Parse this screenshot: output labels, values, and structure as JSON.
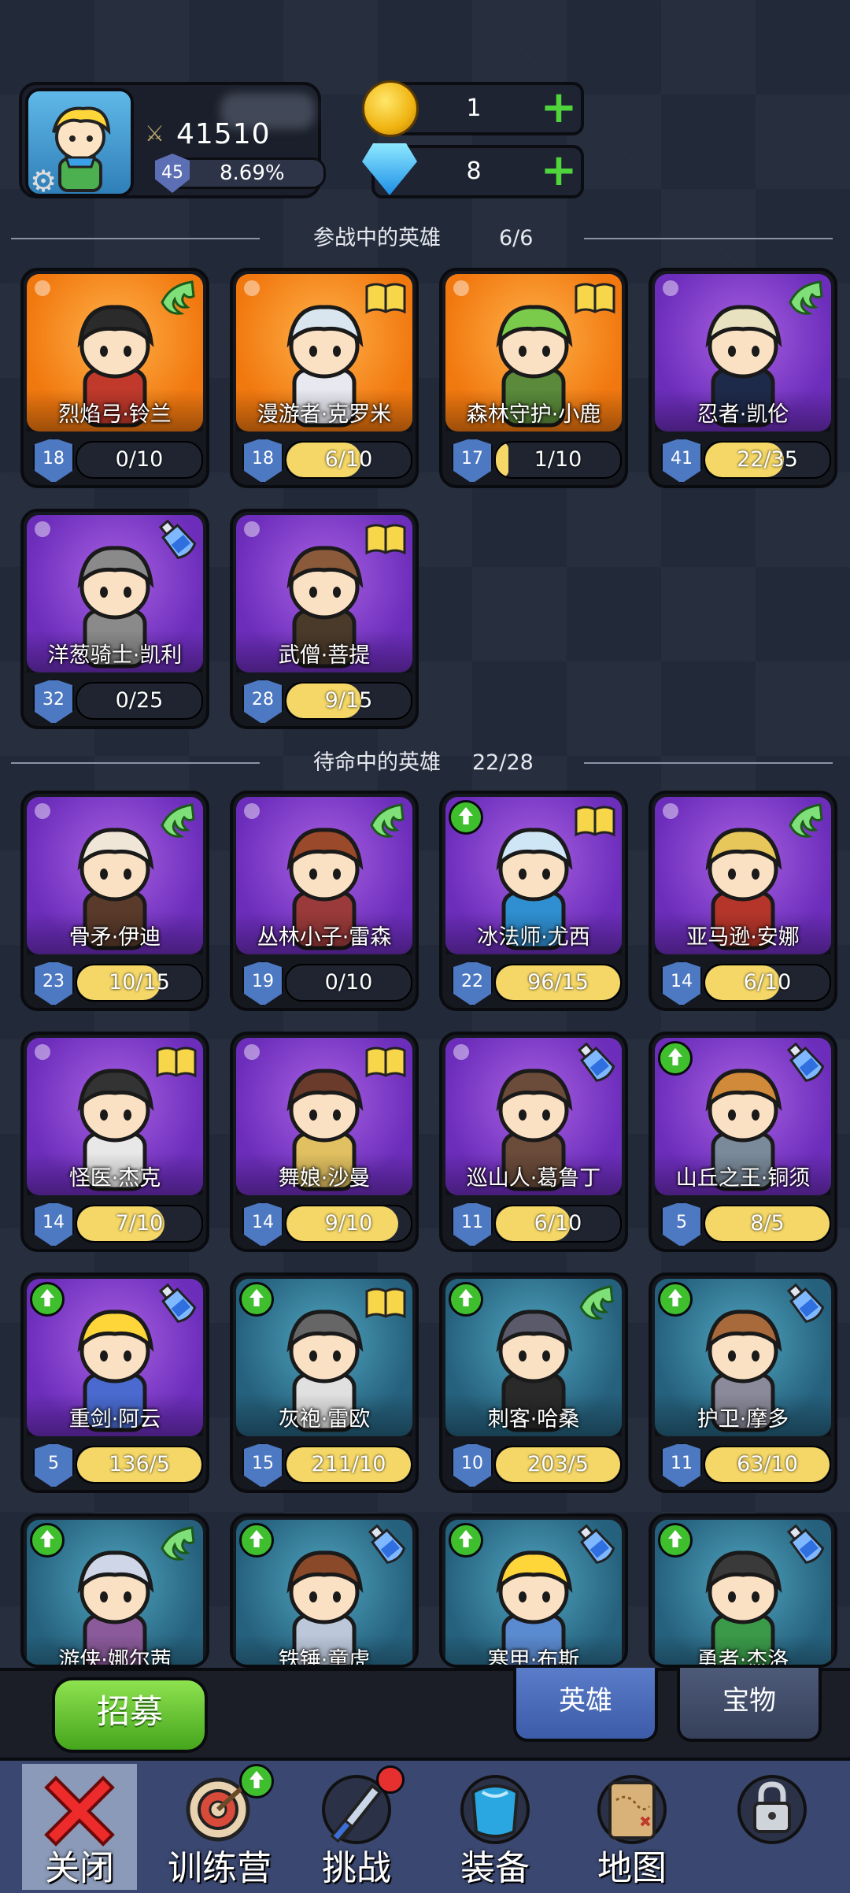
{
  "player": {
    "power": "41510",
    "level": "45",
    "exp_percent_text": "8.69%",
    "exp_fraction": 0.0869
  },
  "currency": {
    "gold": "1",
    "gems": "8"
  },
  "active_section": {
    "title": "参战中的英雄",
    "count": "6/6"
  },
  "reserve_section": {
    "title": "待命中的英雄",
    "count": "22/28"
  },
  "active_heroes": [
    {
      "name": "烈焰弓·铃兰",
      "level": "18",
      "progress": "0/10",
      "fill": 0.0,
      "bg": "orange",
      "badge": "wing",
      "upgrade": false
    },
    {
      "name": "漫游者·克罗米",
      "level": "18",
      "progress": "6/10",
      "fill": 0.6,
      "bg": "orange",
      "badge": "book",
      "upgrade": false
    },
    {
      "name": "森林守护·小鹿",
      "level": "17",
      "progress": "1/10",
      "fill": 0.1,
      "bg": "orange",
      "badge": "book",
      "upgrade": false
    },
    {
      "name": "忍者·凯伦",
      "level": "41",
      "progress": "22/35",
      "fill": 0.63,
      "bg": "purple",
      "badge": "wing",
      "upgrade": false
    },
    {
      "name": "洋葱骑士·凯利",
      "level": "32",
      "progress": "0/25",
      "fill": 0.0,
      "bg": "purple",
      "badge": "potion",
      "upgrade": false
    },
    {
      "name": "武僧·菩提",
      "level": "28",
      "progress": "9/15",
      "fill": 0.6,
      "bg": "purple",
      "badge": "book",
      "upgrade": false
    }
  ],
  "reserve_heroes": [
    {
      "name": "骨矛·伊迪",
      "level": "23",
      "progress": "10/15",
      "fill": 0.67,
      "bg": "purple",
      "badge": "wing",
      "upgrade": false
    },
    {
      "name": "丛林小子·雷森",
      "level": "19",
      "progress": "0/10",
      "fill": 0.0,
      "bg": "purple",
      "badge": "wing",
      "upgrade": false
    },
    {
      "name": "冰法师·尤西",
      "level": "22",
      "progress": "96/15",
      "fill": 1.0,
      "bg": "purple",
      "badge": "book",
      "upgrade": true
    },
    {
      "name": "亚马逊·安娜",
      "level": "14",
      "progress": "6/10",
      "fill": 0.6,
      "bg": "purple",
      "badge": "wing",
      "upgrade": false
    },
    {
      "name": "怪医·杰克",
      "level": "14",
      "progress": "7/10",
      "fill": 0.7,
      "bg": "purple",
      "badge": "book",
      "upgrade": false
    },
    {
      "name": "舞娘·沙曼",
      "level": "14",
      "progress": "9/10",
      "fill": 0.9,
      "bg": "purple",
      "badge": "book",
      "upgrade": false
    },
    {
      "name": "巡山人·葛鲁丁",
      "level": "11",
      "progress": "6/10",
      "fill": 0.6,
      "bg": "purple",
      "badge": "potion",
      "upgrade": false
    },
    {
      "name": "山丘之王·铜须",
      "level": "5",
      "progress": "8/5",
      "fill": 1.0,
      "bg": "purple",
      "badge": "potion",
      "upgrade": true
    },
    {
      "name": "重剑·阿云",
      "level": "5",
      "progress": "136/5",
      "fill": 1.0,
      "bg": "purple",
      "badge": "potion",
      "upgrade": true
    },
    {
      "name": "灰袍·雷欧",
      "level": "15",
      "progress": "211/10",
      "fill": 1.0,
      "bg": "teal",
      "badge": "book",
      "upgrade": true
    },
    {
      "name": "刺客·哈桑",
      "level": "10",
      "progress": "203/5",
      "fill": 1.0,
      "bg": "teal",
      "badge": "wing",
      "upgrade": true
    },
    {
      "name": "护卫·摩多",
      "level": "11",
      "progress": "63/10",
      "fill": 1.0,
      "bg": "teal",
      "badge": "potion",
      "upgrade": true
    },
    {
      "name": "游侠·娜尔茜",
      "level": "",
      "progress": "",
      "fill": 0.0,
      "bg": "teal",
      "badge": "wing",
      "upgrade": true
    },
    {
      "name": "铁锤·童虎",
      "level": "",
      "progress": "",
      "fill": 0.0,
      "bg": "teal",
      "badge": "potion",
      "upgrade": true
    },
    {
      "name": "寒甲·布斯",
      "level": "",
      "progress": "",
      "fill": 0.0,
      "bg": "teal",
      "badge": "potion",
      "upgrade": true
    },
    {
      "name": "勇者·杰洛",
      "level": "",
      "progress": "",
      "fill": 0.0,
      "bg": "teal",
      "badge": "potion",
      "upgrade": true
    }
  ],
  "buttons": {
    "recruit": "招募",
    "tab_heroes": "英雄",
    "tab_treasure": "宝物"
  },
  "nav": [
    {
      "label": "关闭",
      "icon": "close-icon",
      "badge": false
    },
    {
      "label": "训练营",
      "icon": "target-icon",
      "badge": "upgrade"
    },
    {
      "label": "挑战",
      "icon": "sword-icon",
      "badge": "dot"
    },
    {
      "label": "装备",
      "icon": "armor-icon",
      "badge": false
    },
    {
      "label": "地图",
      "icon": "map-icon",
      "badge": false
    },
    {
      "label": "",
      "icon": "locked-icon",
      "badge": false
    }
  ],
  "colors": {
    "background": "#222a3a",
    "progress_fill": "#f4d766",
    "level_shield": "#4d78c2",
    "recruit_green": "#45a51c",
    "plus_green": "#4fd43b"
  }
}
